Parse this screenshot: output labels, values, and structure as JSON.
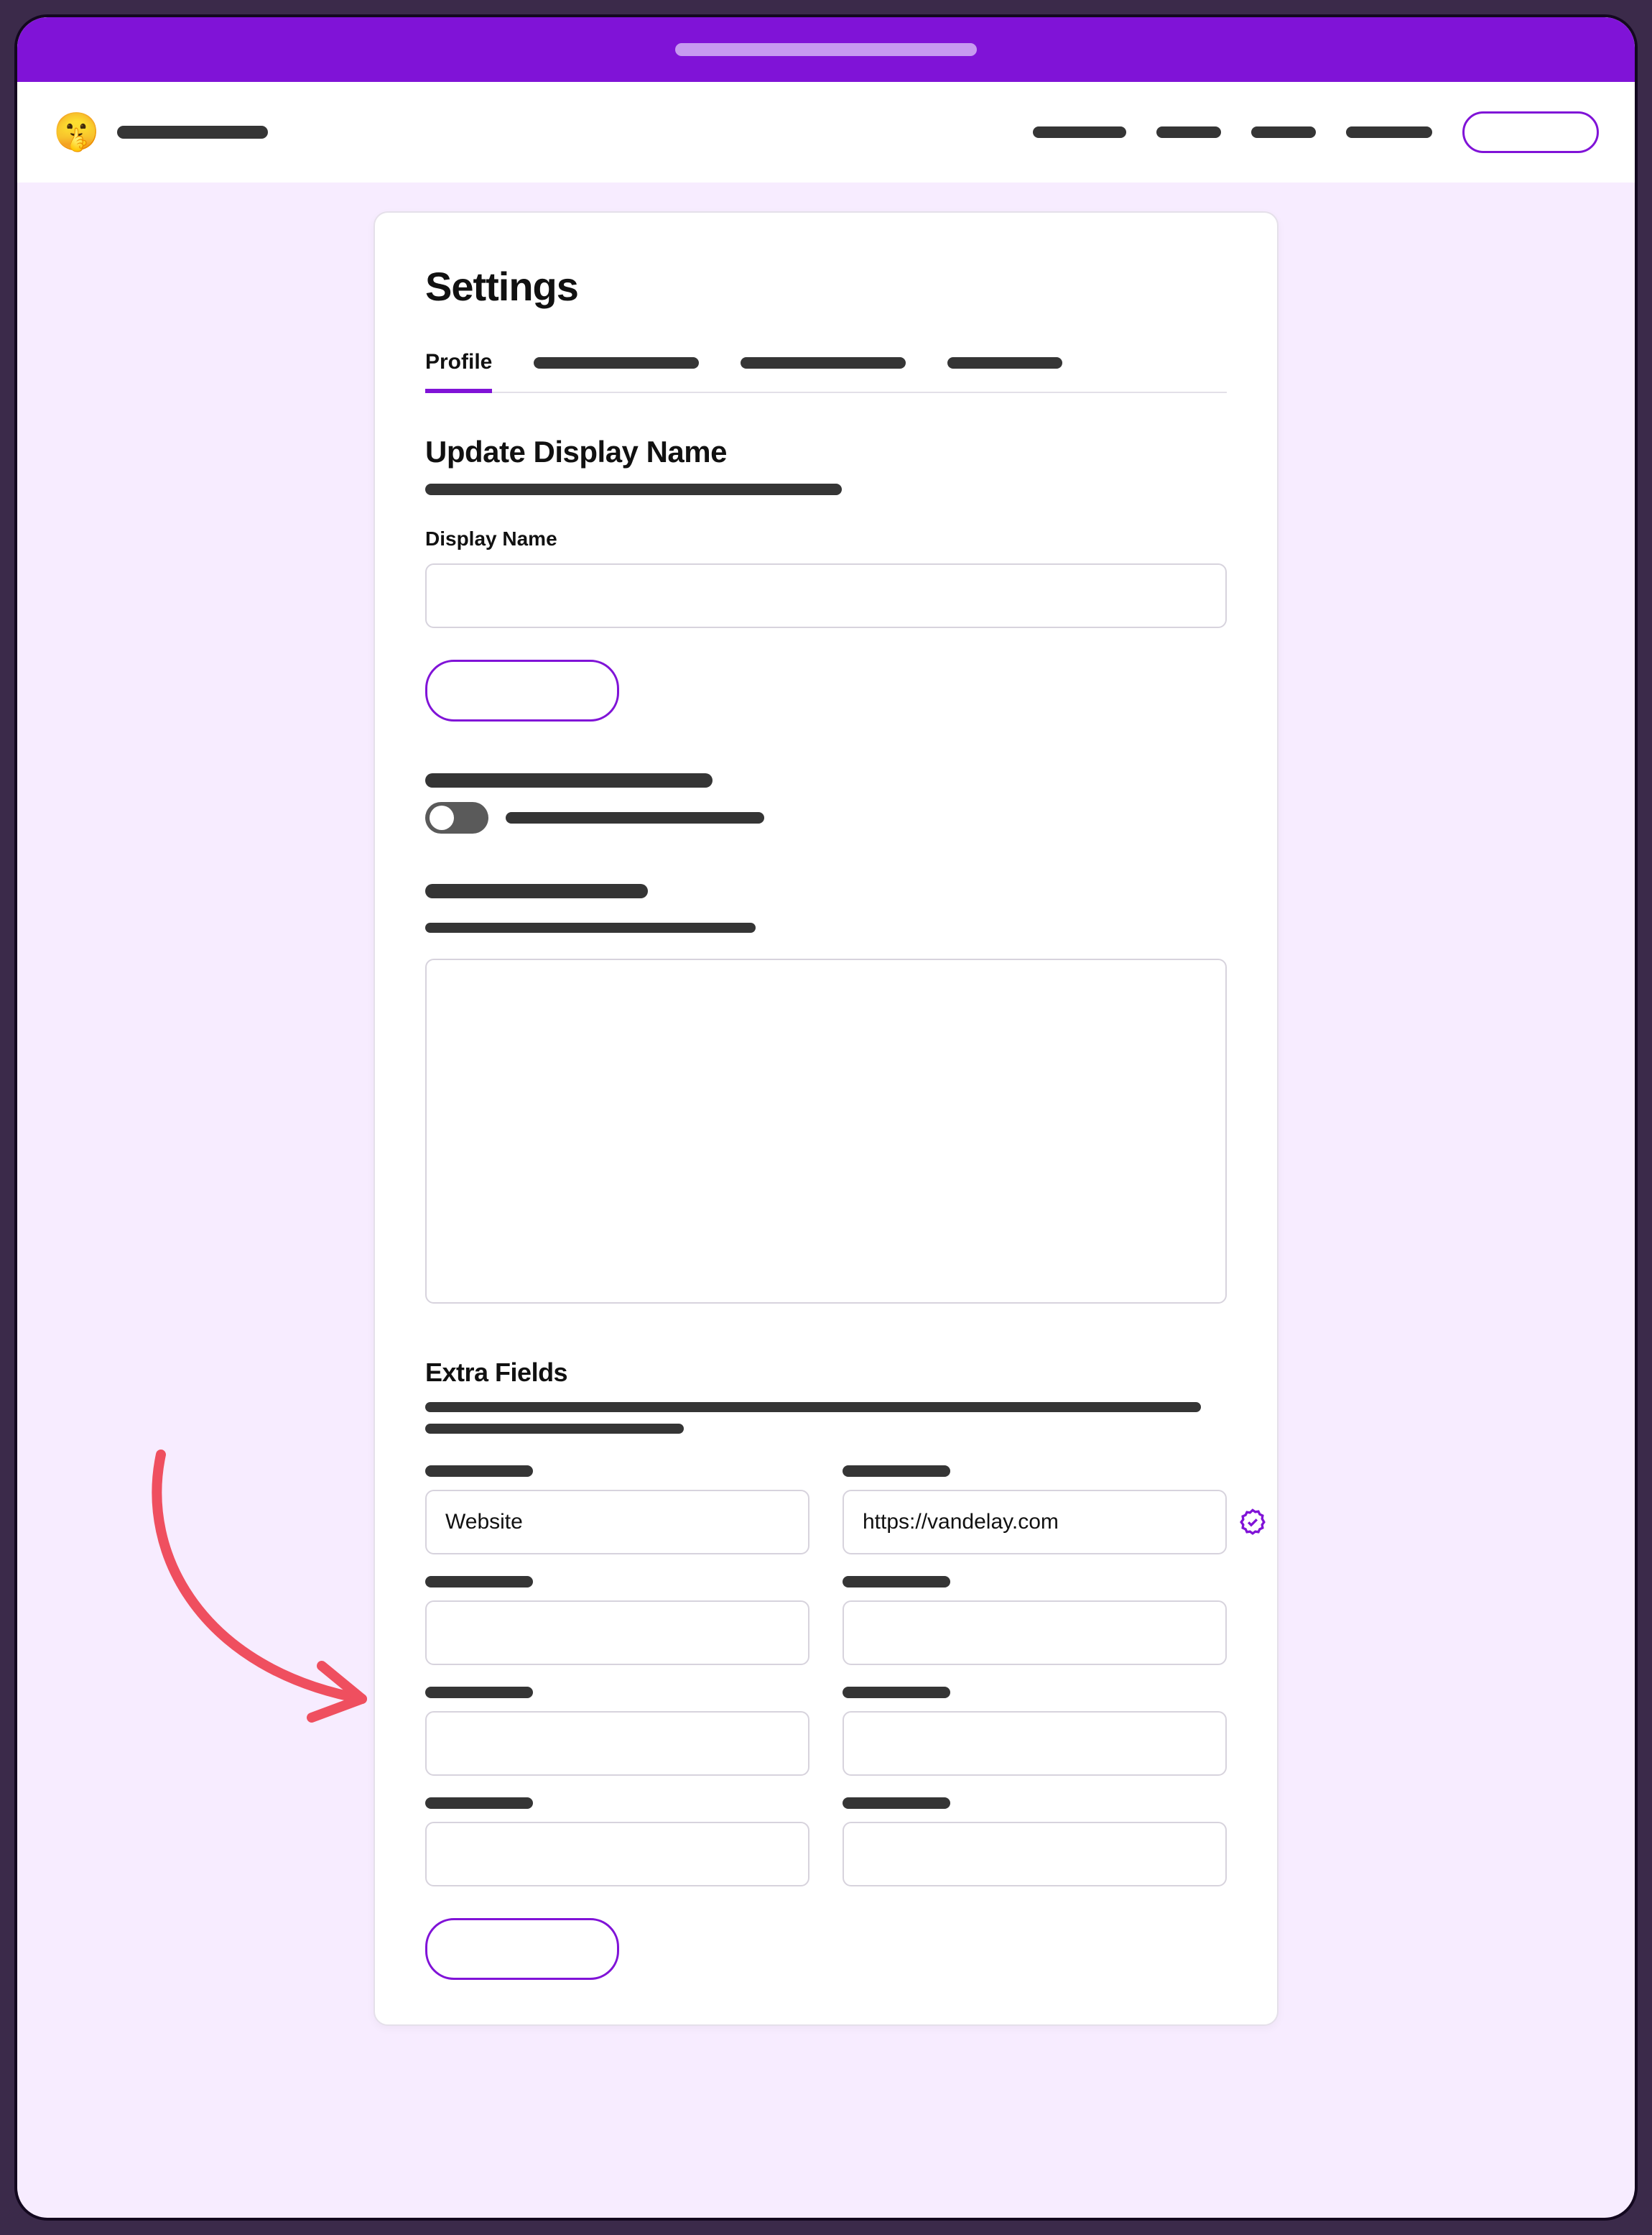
{
  "header": {
    "logo_emoji": "🤫",
    "cta_label": ""
  },
  "page": {
    "title": "Settings",
    "tabs": {
      "active": "Profile"
    },
    "section_update_name": {
      "heading": "Update Display Name",
      "field_label": "Display Name",
      "field_value": ""
    },
    "section_extra_fields": {
      "heading": "Extra Fields",
      "rows": [
        {
          "name": "Website",
          "value": "https://vandelay.com",
          "verified": true
        },
        {
          "name": "",
          "value": "",
          "verified": false
        },
        {
          "name": "",
          "value": "",
          "verified": false
        },
        {
          "name": "",
          "value": "",
          "verified": false
        }
      ]
    }
  },
  "colors": {
    "accent": "#8013d7",
    "annotation": "#ef4f5f"
  }
}
